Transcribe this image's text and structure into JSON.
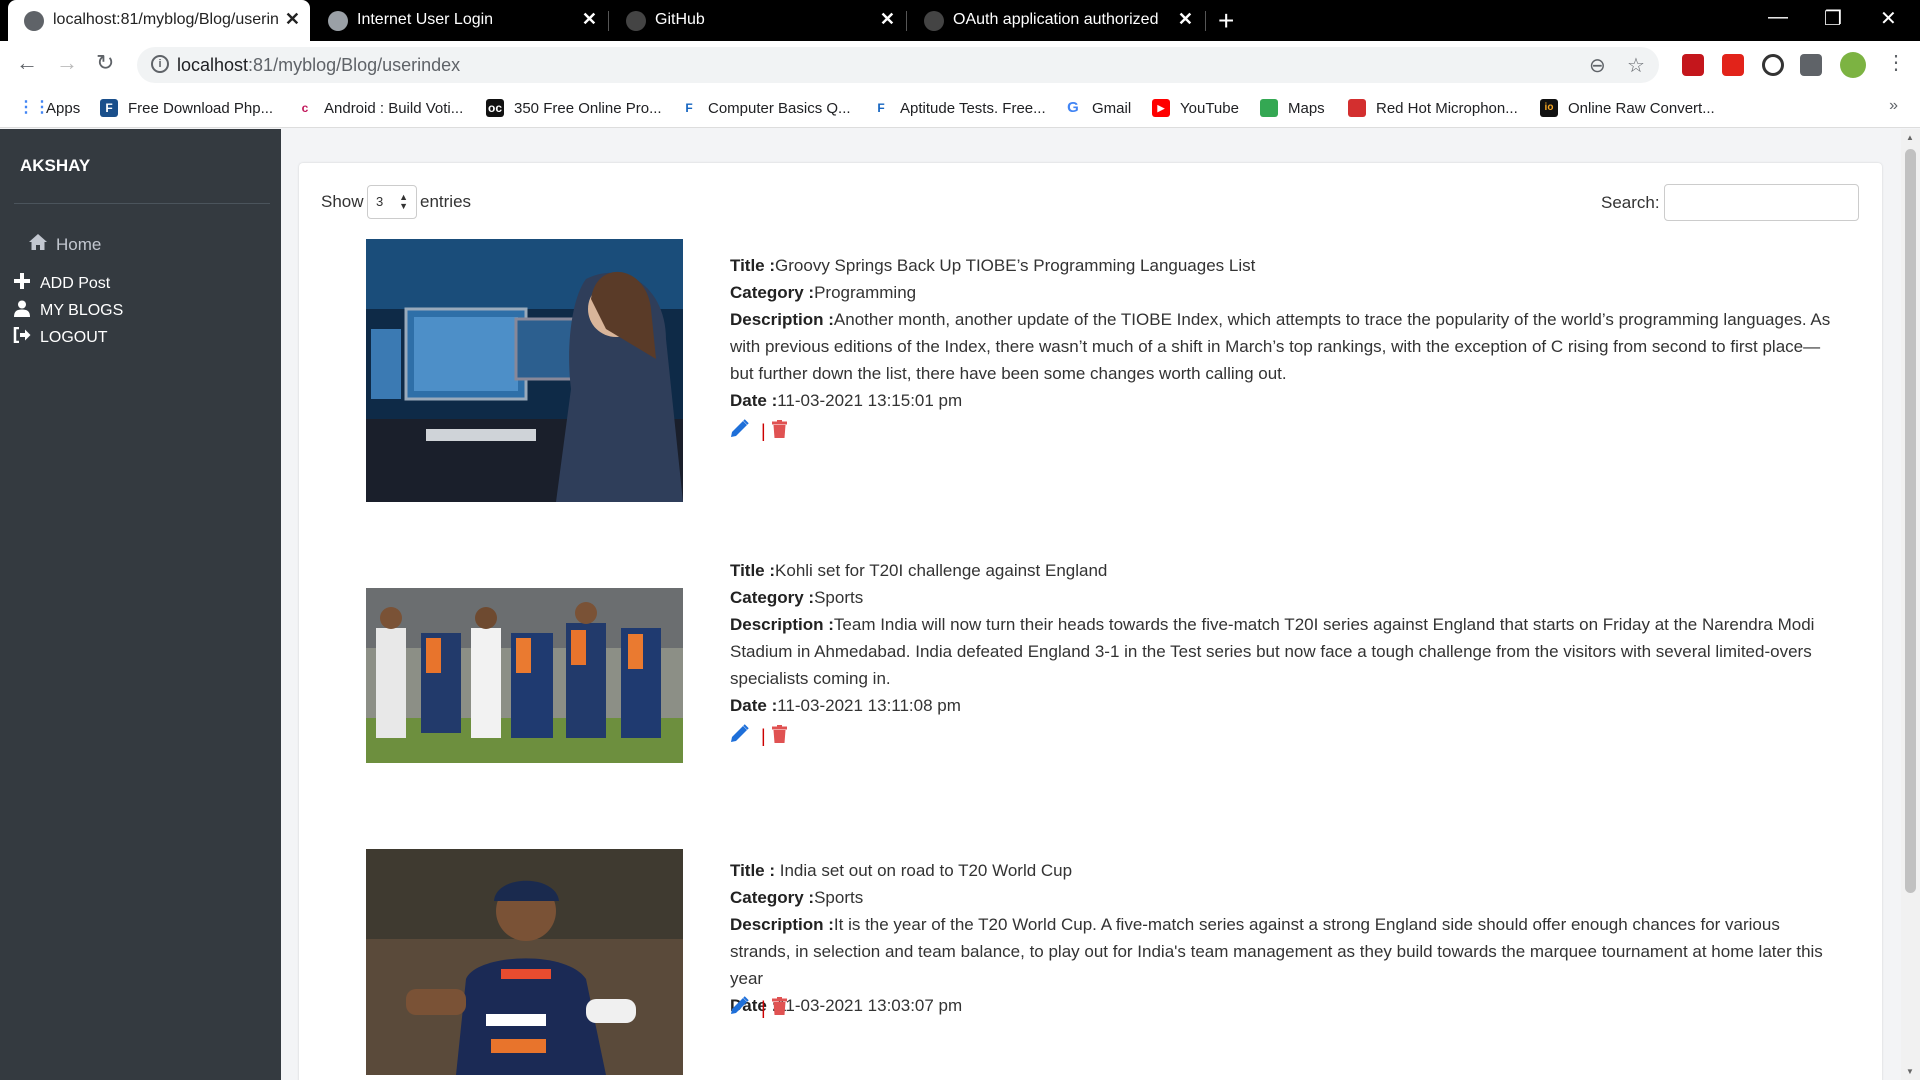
{
  "browser": {
    "tabs": [
      {
        "title": "localhost:81/myblog/Blog/userin",
        "active": true
      },
      {
        "title": "Internet User Login",
        "active": false
      },
      {
        "title": "GitHub",
        "active": false
      },
      {
        "title": "OAuth application authorized",
        "active": false
      }
    ],
    "url_host": "localhost",
    "url_path": ":81/myblog/Blog/userindex",
    "bookmarks": [
      "Apps",
      "Free Download Php...",
      "Android : Build Voti...",
      "350 Free Online Pro...",
      "Computer Basics Q...",
      "Aptitude Tests. Free...",
      "Gmail",
      "YouTube",
      "Maps",
      "Red Hot Microphon...",
      "Online Raw Convert..."
    ]
  },
  "sidebar": {
    "brand": "AKSHAY",
    "home_label": "Home",
    "items": [
      {
        "label": "ADD Post"
      },
      {
        "label": "MY BLOGS"
      },
      {
        "label": "LOGOUT"
      }
    ]
  },
  "table_controls": {
    "show_label": "Show",
    "page_size": "3",
    "entries_label": "entries",
    "search_label": "Search:",
    "search_value": ""
  },
  "labels": {
    "title": "Title :",
    "category": "Category :",
    "description": "Description :",
    "date": "Date :",
    "separator": "|"
  },
  "posts": [
    {
      "title": "Groovy Springs Back Up TIOBE’s Programming Languages List",
      "category": "Programming",
      "description": "Another month, another update of the TIOBE Index, which attempts to trace the popularity of the world’s programming languages. As with previous editions of the Index, there wasn’t much of a shift in March’s top rankings, with the exception of C rising from second to first place—but further down the list, there have been some changes worth calling out.",
      "date": "11-03-2021 13:15:01 pm"
    },
    {
      "title": "Kohli set for T20I challenge against England",
      "category": "Sports",
      "description": "Team India will now turn their heads towards the five-match T20I series against England that starts on Friday at the Narendra Modi Stadium in Ahmedabad. India defeated England 3-1 in the Test series but now face a tough challenge from the visitors with several limited-overs specialists coming in.",
      "date": "11-03-2021 13:11:08 pm"
    },
    {
      "title": " India set out on road to T20 World Cup",
      "category": "Sports",
      "description": "It is the year of the T20 World Cup. A five-match series against a strong England side should offer enough chances for various strands, in selection and team balance, to play out for India's team management as they build towards the marquee tournament at home later this year",
      "date": "11-03-2021 13:03:07 pm"
    }
  ],
  "colors": {
    "sidebar_bg": "#343a40",
    "edit_icon": "#1e6fd9",
    "delete_icon": "#e05252"
  }
}
